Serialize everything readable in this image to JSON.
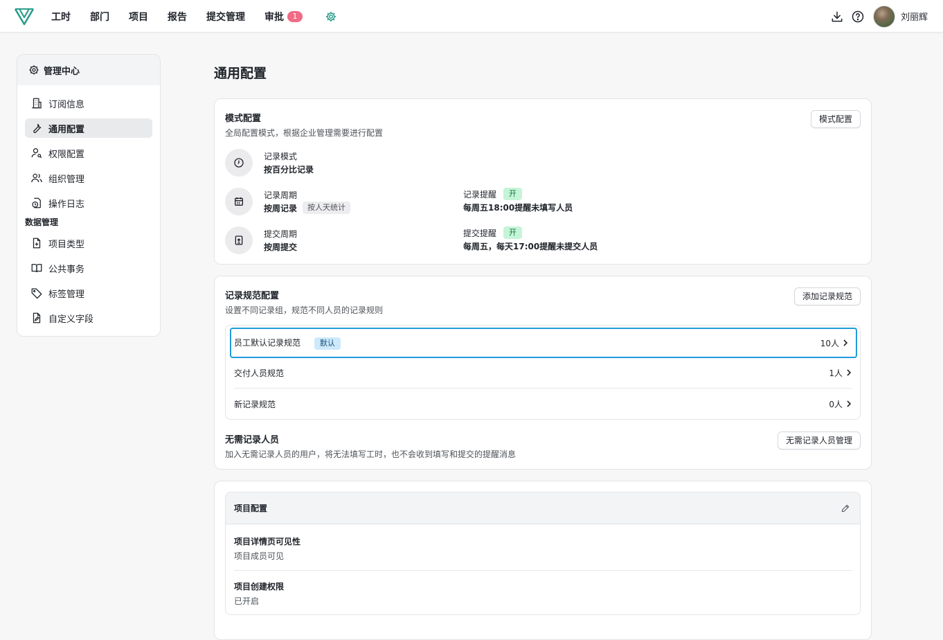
{
  "nav": {
    "items": [
      "工时",
      "部门",
      "项目",
      "报告",
      "提交管理"
    ],
    "approval_label": "审批",
    "approval_badge": "1",
    "user_name": "刘丽辉"
  },
  "sidebar": {
    "title": "管理中心",
    "items": [
      "订阅信息",
      "通用配置",
      "权限配置",
      "组织管理",
      "操作日志"
    ],
    "group_label": "数据管理",
    "data_items": [
      "项目类型",
      "公共事务",
      "标签管理",
      "自定义字段"
    ]
  },
  "page": {
    "title": "通用配置"
  },
  "mode_config": {
    "title": "模式配置",
    "desc": "全局配置模式，根据企业管理需要进行配置",
    "button": "模式配置",
    "record_mode_label": "记录模式",
    "record_mode_value": "按百分比记录",
    "record_cycle_label": "记录周期",
    "record_cycle_value": "按周记录",
    "record_cycle_tag": "按人天统计",
    "record_remind_label": "记录提醒",
    "record_remind_tag": "开",
    "record_remind_value": "每周五18:00提醒未填写人员",
    "submit_cycle_label": "提交周期",
    "submit_cycle_value": "按周提交",
    "submit_remind_label": "提交提醒",
    "submit_remind_tag": "开",
    "submit_remind_value": "每周五，每天17:00提醒未提交人员"
  },
  "rules": {
    "title": "记录规范配置",
    "desc": "设置不同记录组，规范不同人员的记录规则",
    "add_button": "添加记录规范",
    "items": [
      {
        "name": "员工默认记录规范",
        "tag": "默认",
        "count": "10人"
      },
      {
        "name": "交付人员规范",
        "count": "1人"
      },
      {
        "name": "新记录规范",
        "count": "0人"
      }
    ],
    "exempt_title": "无需记录人员",
    "exempt_desc": "加入无需记录人员的用户，将无法填写工时，也不会收到填写和提交的提醒消息",
    "exempt_button": "无需记录人员管理"
  },
  "project": {
    "title": "项目配置",
    "visibility_label": "项目详情页可见性",
    "visibility_value": "项目成员可见",
    "create_label": "项目创建权限",
    "create_value": "已开启"
  }
}
